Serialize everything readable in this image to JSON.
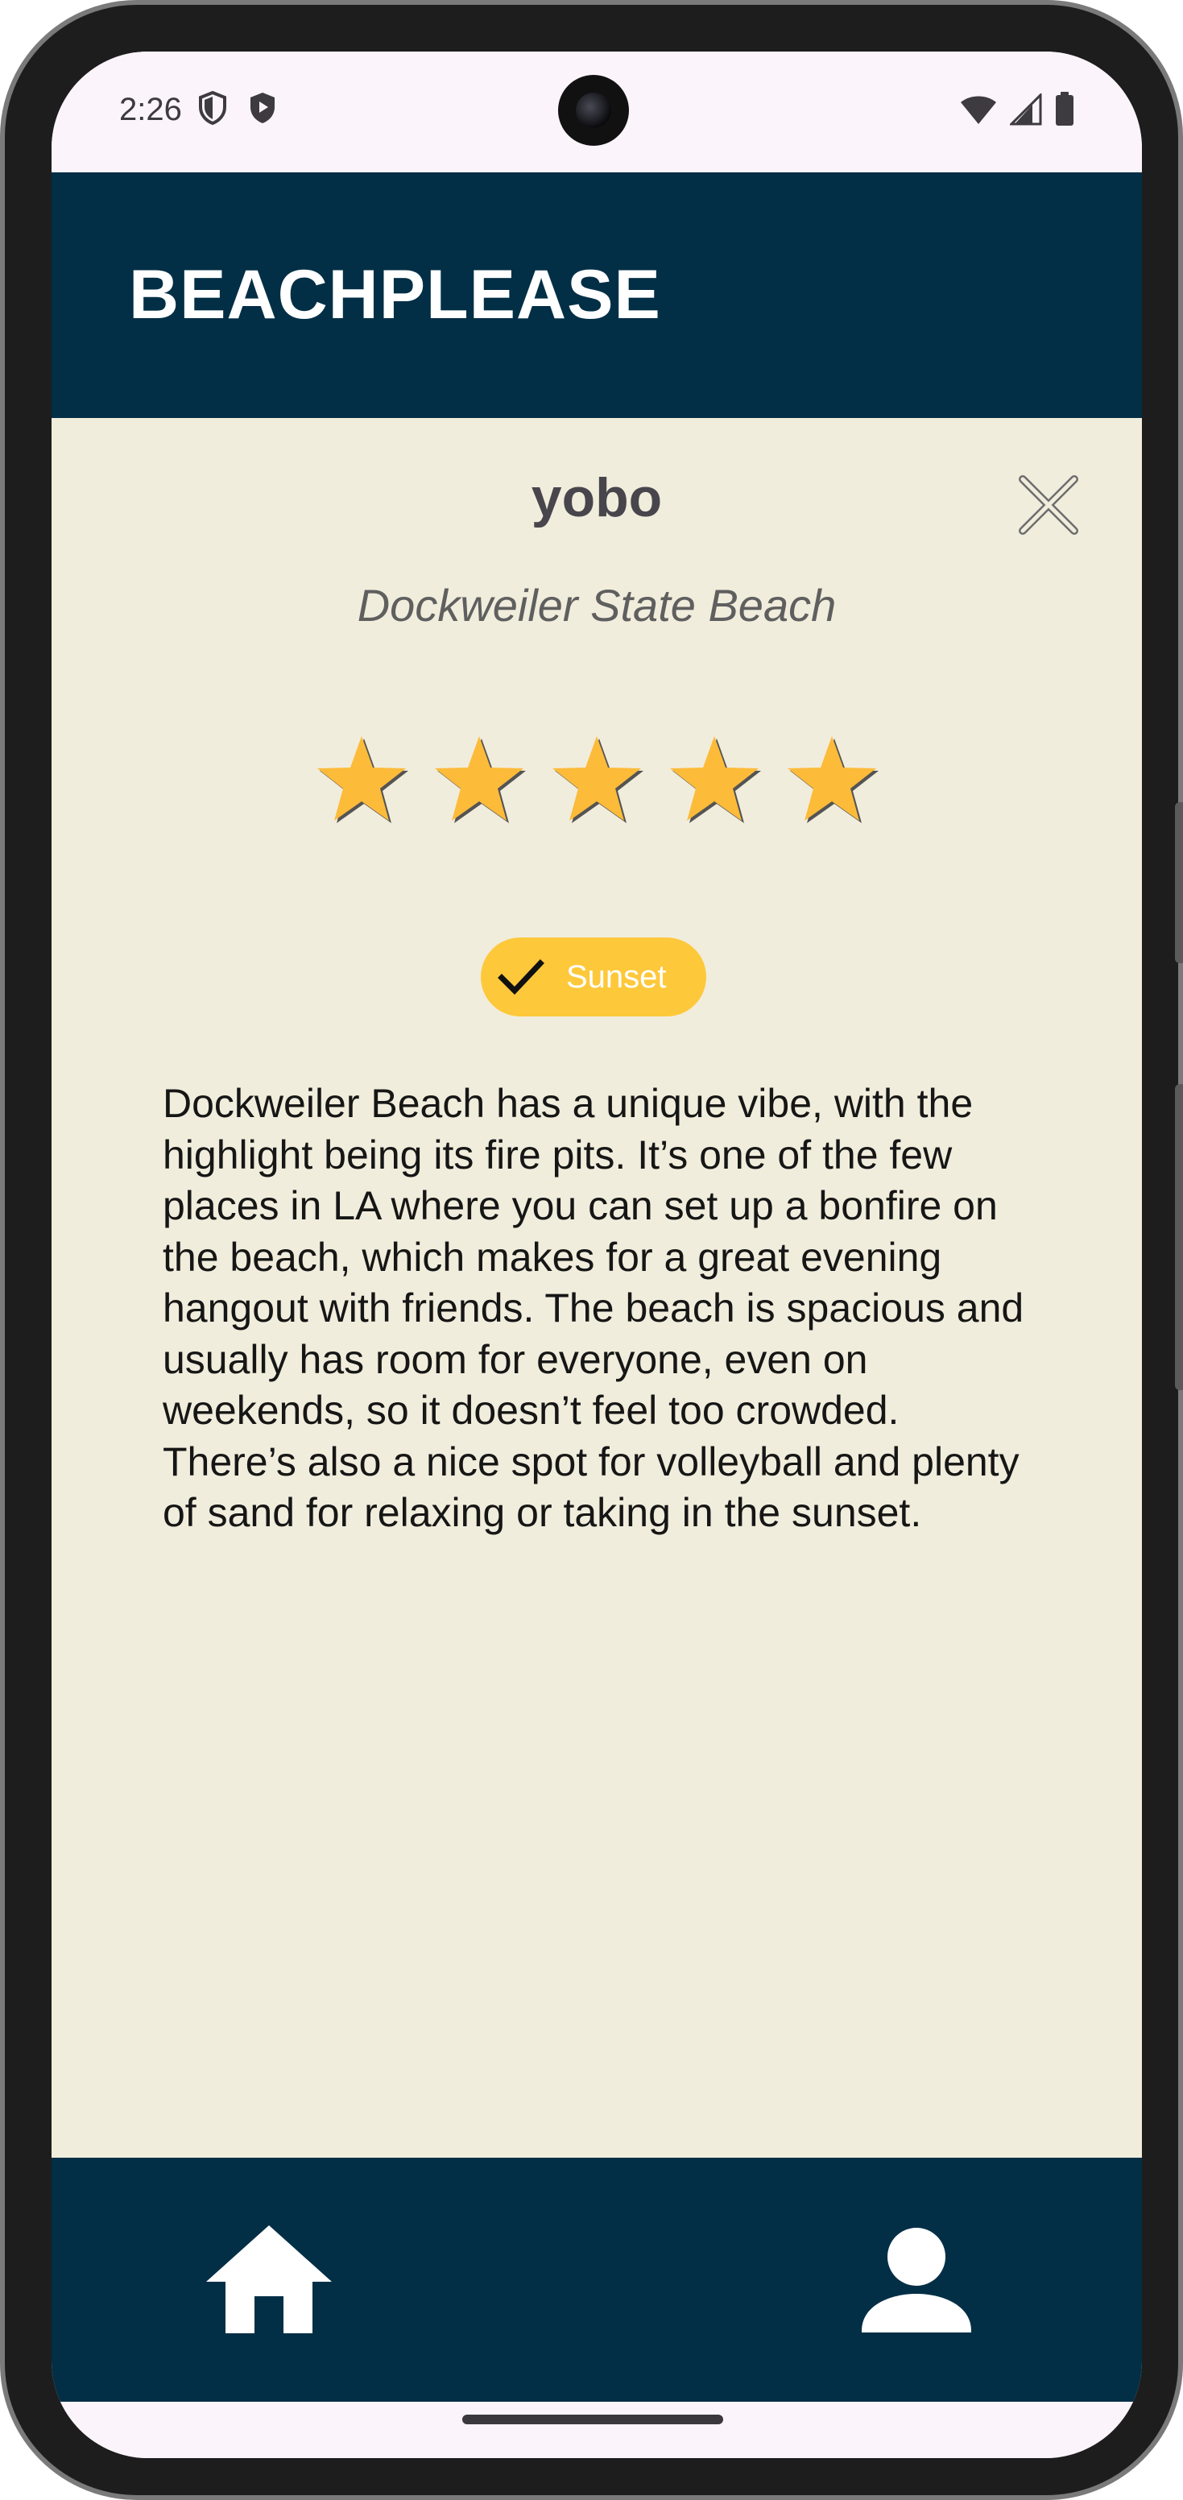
{
  "status_bar": {
    "time": "2:26",
    "left_icons": [
      "shield-outline-icon",
      "shield-play-icon"
    ],
    "right_icons": [
      "wifi-icon",
      "cellular-signal-icon",
      "battery-icon"
    ]
  },
  "app_bar": {
    "title": "BEACHPLEASE"
  },
  "review": {
    "username": "yobo",
    "beach_name": "Dockweiler State Beach",
    "rating": 5,
    "rating_max": 5,
    "tag": {
      "label": "Sunset",
      "selected": true
    },
    "body": "Dockweiler Beach has a unique vibe, with the highlight being its fire pits. It’s one of the few places in LA where you can set up a bonfire on the beach, which makes for a great evening hangout with friends. The beach is spacious and usually has room for everyone, even on weekends, so it doesn’t feel too crowded. There’s also a nice spot for volleyball and plenty of sand for relaxing or taking in the sunset."
  },
  "bottom_nav": {
    "items": [
      {
        "icon": "home-icon"
      },
      {
        "icon": "person-icon"
      }
    ]
  },
  "colors": {
    "app_bar": "#022f46",
    "content_background": "#f1eddc",
    "star": "#fdbb3a",
    "chip": "#fdc83a",
    "system_bar": "#fcf4fb"
  }
}
